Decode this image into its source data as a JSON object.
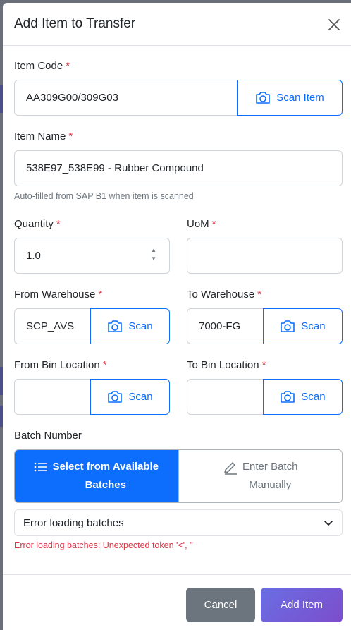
{
  "modal": {
    "title": "Add Item to Transfer"
  },
  "item_code": {
    "label": "Item Code",
    "required_mark": "*",
    "value": "AA309G00/309G03",
    "scan_label": "Scan Item"
  },
  "item_name": {
    "label": "Item Name",
    "required_mark": "*",
    "value": "538E97_538E99 - Rubber Compound",
    "help": "Auto-filled from SAP B1 when item is scanned"
  },
  "quantity": {
    "label": "Quantity",
    "required_mark": "*",
    "value": "1.0"
  },
  "uom": {
    "label": "UoM",
    "required_mark": "*",
    "value": ""
  },
  "from_warehouse": {
    "label": "From Warehouse",
    "required_mark": "*",
    "value": "SCP_AVS",
    "scan_label": "Scan"
  },
  "to_warehouse": {
    "label": "To Warehouse",
    "required_mark": "*",
    "value": "7000-FG",
    "scan_label": "Scan"
  },
  "from_bin": {
    "label": "From Bin Location",
    "required_mark": "*",
    "value": "",
    "scan_label": "Scan"
  },
  "to_bin": {
    "label": "To Bin Location",
    "required_mark": "*",
    "value": "",
    "scan_label": "Scan"
  },
  "batch": {
    "label": "Batch Number",
    "select_available_line1": "Select from Available",
    "select_available_line2": "Batches",
    "enter_manual_line1": "Enter Batch",
    "enter_manual_line2": "Manually",
    "dropdown_value": "Error loading batches",
    "error": "Error loading batches: Unexpected token '<', \""
  },
  "footer": {
    "cancel_label": "Cancel",
    "add_label": "Add Item"
  },
  "colors": {
    "primary": "#0d6efd",
    "danger": "#dc3545",
    "secondary": "#6c757d",
    "add_gradient_start": "#6a6ee3",
    "add_gradient_end": "#7c4dcc"
  }
}
